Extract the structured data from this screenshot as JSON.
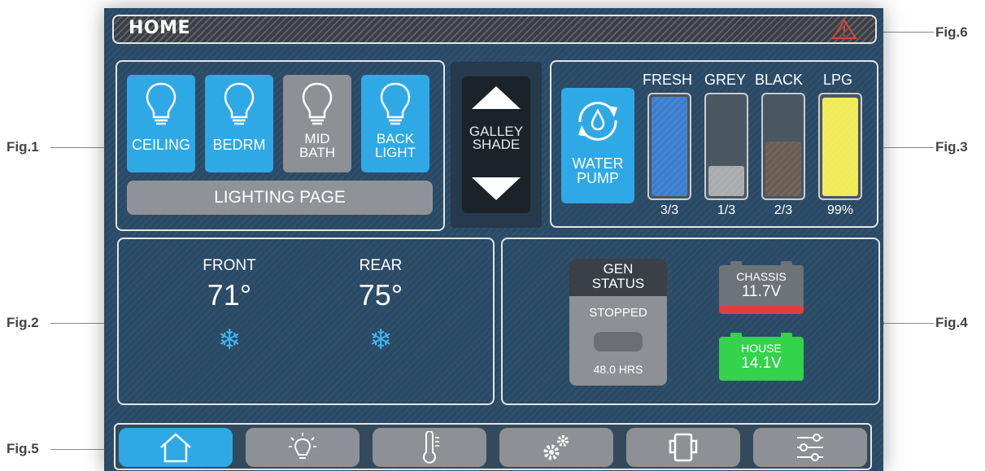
{
  "header": {
    "title": "HOME",
    "alert_icon": "warning-triangle-icon",
    "alert_color": "#e0403c"
  },
  "lighting": {
    "buttons": [
      {
        "label": "CEILING",
        "state": "on"
      },
      {
        "label": "BEDRM",
        "state": "on"
      },
      {
        "label_line1": "MID",
        "label_line2": "BATH",
        "state": "off"
      },
      {
        "label_line1": "BACK",
        "label_line2": "LIGHT",
        "state": "on"
      }
    ],
    "page_button": "LIGHTING PAGE"
  },
  "galley_shade": {
    "label_line1": "GALLEY",
    "label_line2": "SHADE"
  },
  "tanks": {
    "pump": {
      "label_line1": "WATER",
      "label_line2": "PUMP",
      "icon": "water-drop-cycle-icon"
    },
    "items": [
      {
        "name": "FRESH",
        "value": "3/3",
        "level": 1.0,
        "color": "#3d7fcf"
      },
      {
        "name": "GREY",
        "value": "1/3",
        "level": 0.3,
        "color": "#a9acaf"
      },
      {
        "name": "BLACK",
        "value": "2/3",
        "level": 0.55,
        "color": "#6b5e55"
      },
      {
        "name": "LPG",
        "value": "99%",
        "level": 0.99,
        "color": "#f0ea58"
      }
    ]
  },
  "climate": {
    "zones": [
      {
        "name": "FRONT",
        "temp": "71°",
        "mode_icon": "snowflake-icon"
      },
      {
        "name": "REAR",
        "temp": "75°",
        "mode_icon": "snowflake-icon"
      }
    ]
  },
  "power": {
    "generator": {
      "title_line1": "GEN",
      "title_line2": "STATUS",
      "state": "STOPPED",
      "hours": "48.0  HRS"
    },
    "batteries": [
      {
        "name": "CHASSIS",
        "voltage": "11.7V",
        "status_color": "#e0403c"
      },
      {
        "name": "HOUSE",
        "voltage": "14.1V",
        "status_color": "#33d34c"
      }
    ]
  },
  "nav": {
    "items": [
      {
        "id": "home",
        "icon": "home-icon",
        "active": true
      },
      {
        "id": "lighting",
        "icon": "lightbulb-icon",
        "active": false
      },
      {
        "id": "climate",
        "icon": "thermometer-icon",
        "active": false
      },
      {
        "id": "settings",
        "icon": "gears-icon",
        "active": false
      },
      {
        "id": "slides",
        "icon": "slide-out-icon",
        "active": false
      },
      {
        "id": "controls",
        "icon": "sliders-icon",
        "active": false
      }
    ]
  },
  "callouts": [
    "Fig.1",
    "Fig.2",
    "Fig.3",
    "Fig.4",
    "Fig.5",
    "Fig.6"
  ],
  "colors": {
    "accent": "#2fa9e6",
    "inactive": "#8d9195",
    "background": "#2a4a66"
  }
}
